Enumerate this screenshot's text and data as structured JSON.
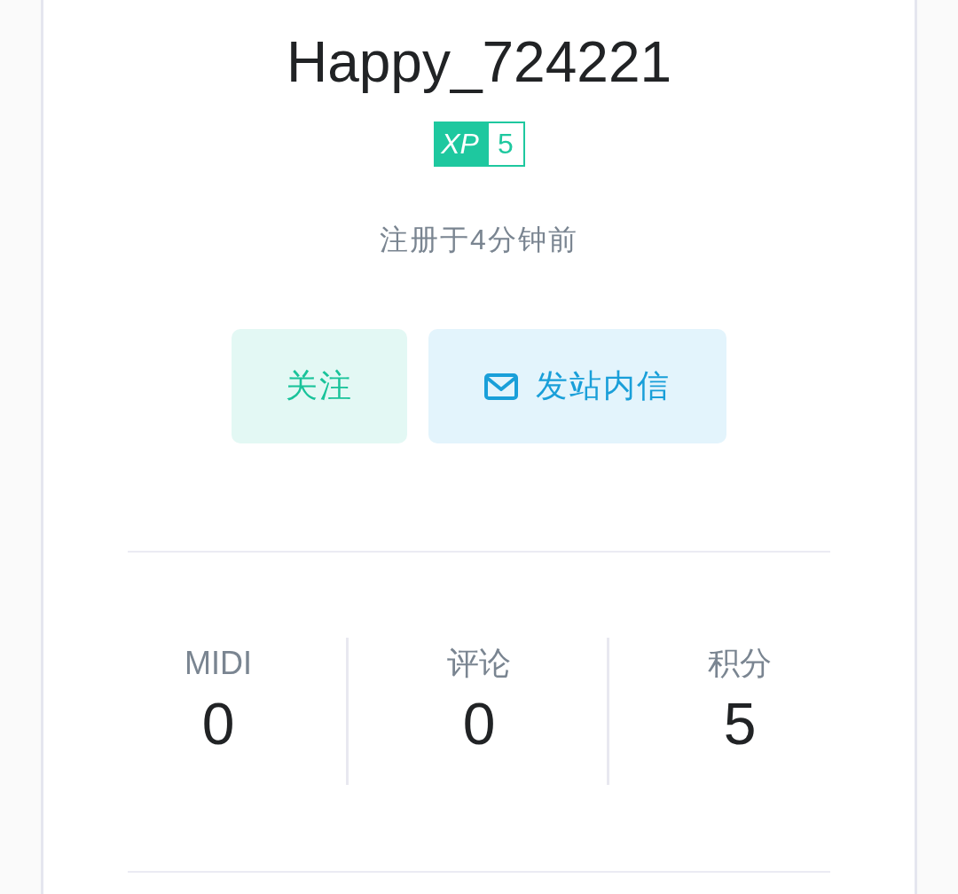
{
  "profile": {
    "username": "Happy_724221",
    "xp": {
      "label": "XP",
      "value": "5"
    },
    "registered": "注册于4分钟前"
  },
  "buttons": [
    {
      "kind": "follow",
      "label": "关注"
    },
    {
      "kind": "message",
      "label": "发站内信"
    }
  ],
  "stats": [
    {
      "label": "MIDI",
      "value": "0"
    },
    {
      "label": "评论",
      "value": "0"
    },
    {
      "label": "积分",
      "value": "5"
    }
  ]
}
